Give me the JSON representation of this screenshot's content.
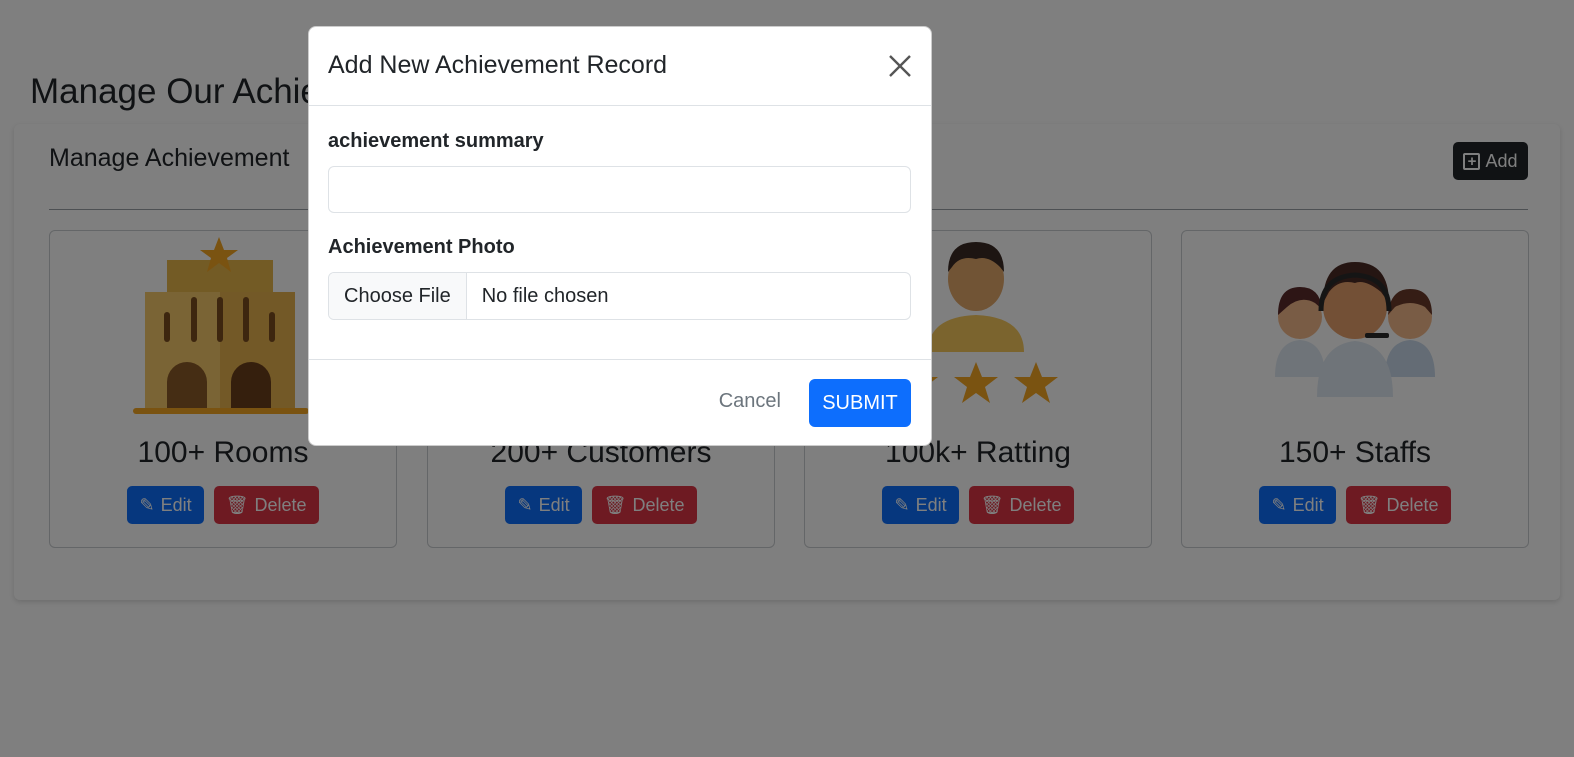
{
  "page": {
    "title": "Manage Our Achievements"
  },
  "panel": {
    "title": "Manage Achievement",
    "add_label": "Add"
  },
  "cards": [
    {
      "title": "100+ Rooms",
      "icon": "hotel-building-icon",
      "edit_label": "Edit",
      "delete_label": "Delete"
    },
    {
      "title": "200+ Customers",
      "icon": "customers-icon",
      "edit_label": "Edit",
      "delete_label": "Delete"
    },
    {
      "title": "100k+ Ratting",
      "icon": "rating-person-stars-icon",
      "edit_label": "Edit",
      "delete_label": "Delete"
    },
    {
      "title": "150+ Staffs",
      "icon": "staff-headset-icon",
      "edit_label": "Edit",
      "delete_label": "Delete"
    }
  ],
  "modal": {
    "title": "Add New Achievement Record",
    "summary_label": "achievement summary",
    "summary_value": "",
    "photo_label": "Achievement Photo",
    "choose_file_label": "Choose File",
    "file_status": "No file chosen",
    "cancel_label": "Cancel",
    "submit_label": "SUBMIT"
  },
  "colors": {
    "primary": "#0d6efd",
    "danger": "#dc3545",
    "dark": "#212529",
    "overlay": "rgba(0,0,0,0.5)"
  }
}
